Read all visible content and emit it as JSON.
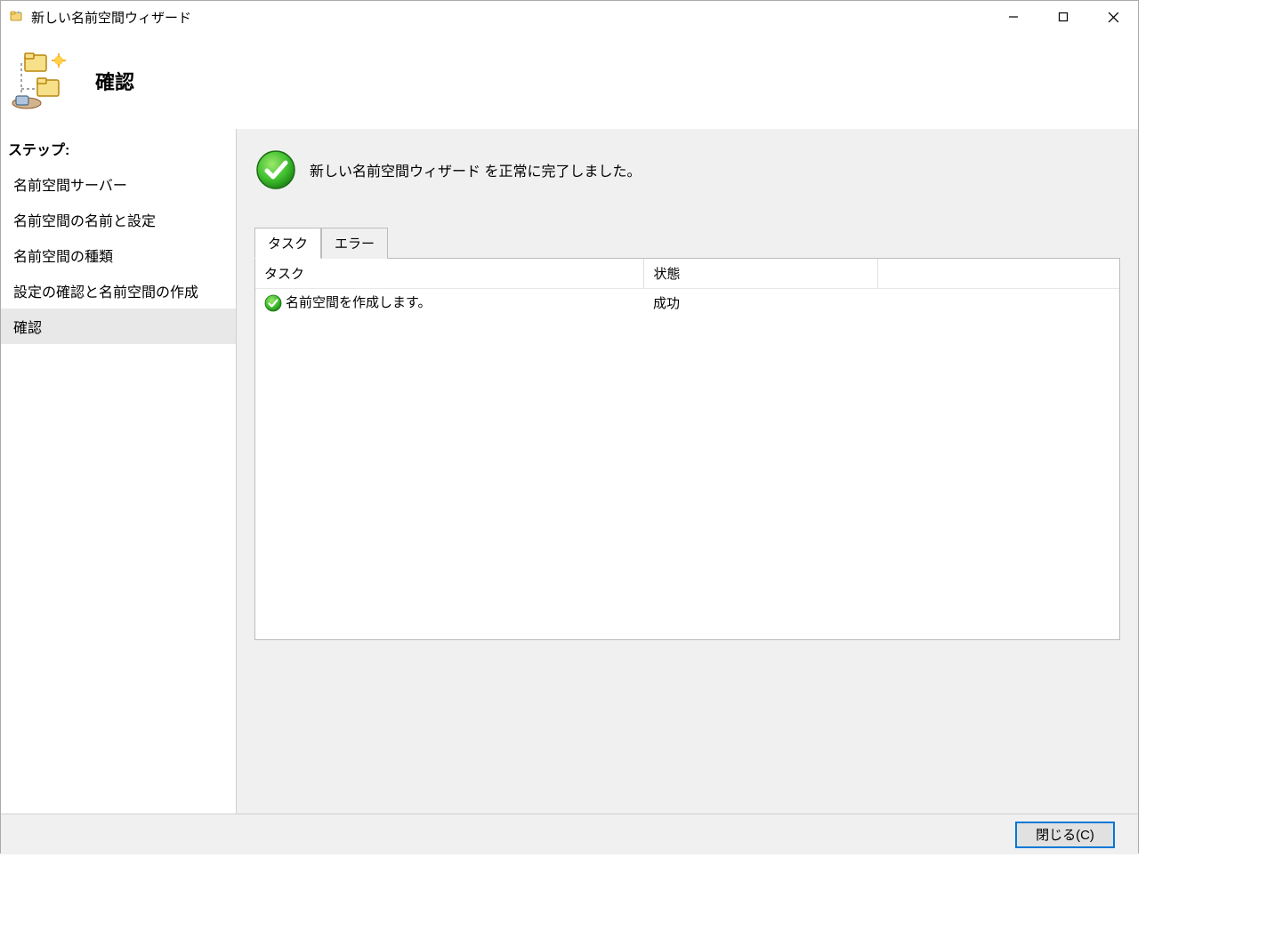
{
  "window": {
    "title": "新しい名前空間ウィザード"
  },
  "header": {
    "title": "確認"
  },
  "sidebar": {
    "heading": "ステップ:",
    "items": [
      {
        "label": "名前空間サーバー",
        "selected": false
      },
      {
        "label": "名前空間の名前と設定",
        "selected": false
      },
      {
        "label": "名前空間の種類",
        "selected": false
      },
      {
        "label": "設定の確認と名前空間の作成",
        "selected": false
      },
      {
        "label": "確認",
        "selected": true
      }
    ]
  },
  "main": {
    "status_message": "新しい名前空間ウィザード を正常に完了しました。",
    "tabs": [
      {
        "label": "タスク",
        "active": true
      },
      {
        "label": "エラー",
        "active": false
      }
    ],
    "table": {
      "columns": [
        "タスク",
        "状態",
        ""
      ],
      "rows": [
        {
          "task": "名前空間を作成します。",
          "status": "成功",
          "icon": "success"
        }
      ]
    }
  },
  "footer": {
    "close_label": "閉じる(C)"
  }
}
